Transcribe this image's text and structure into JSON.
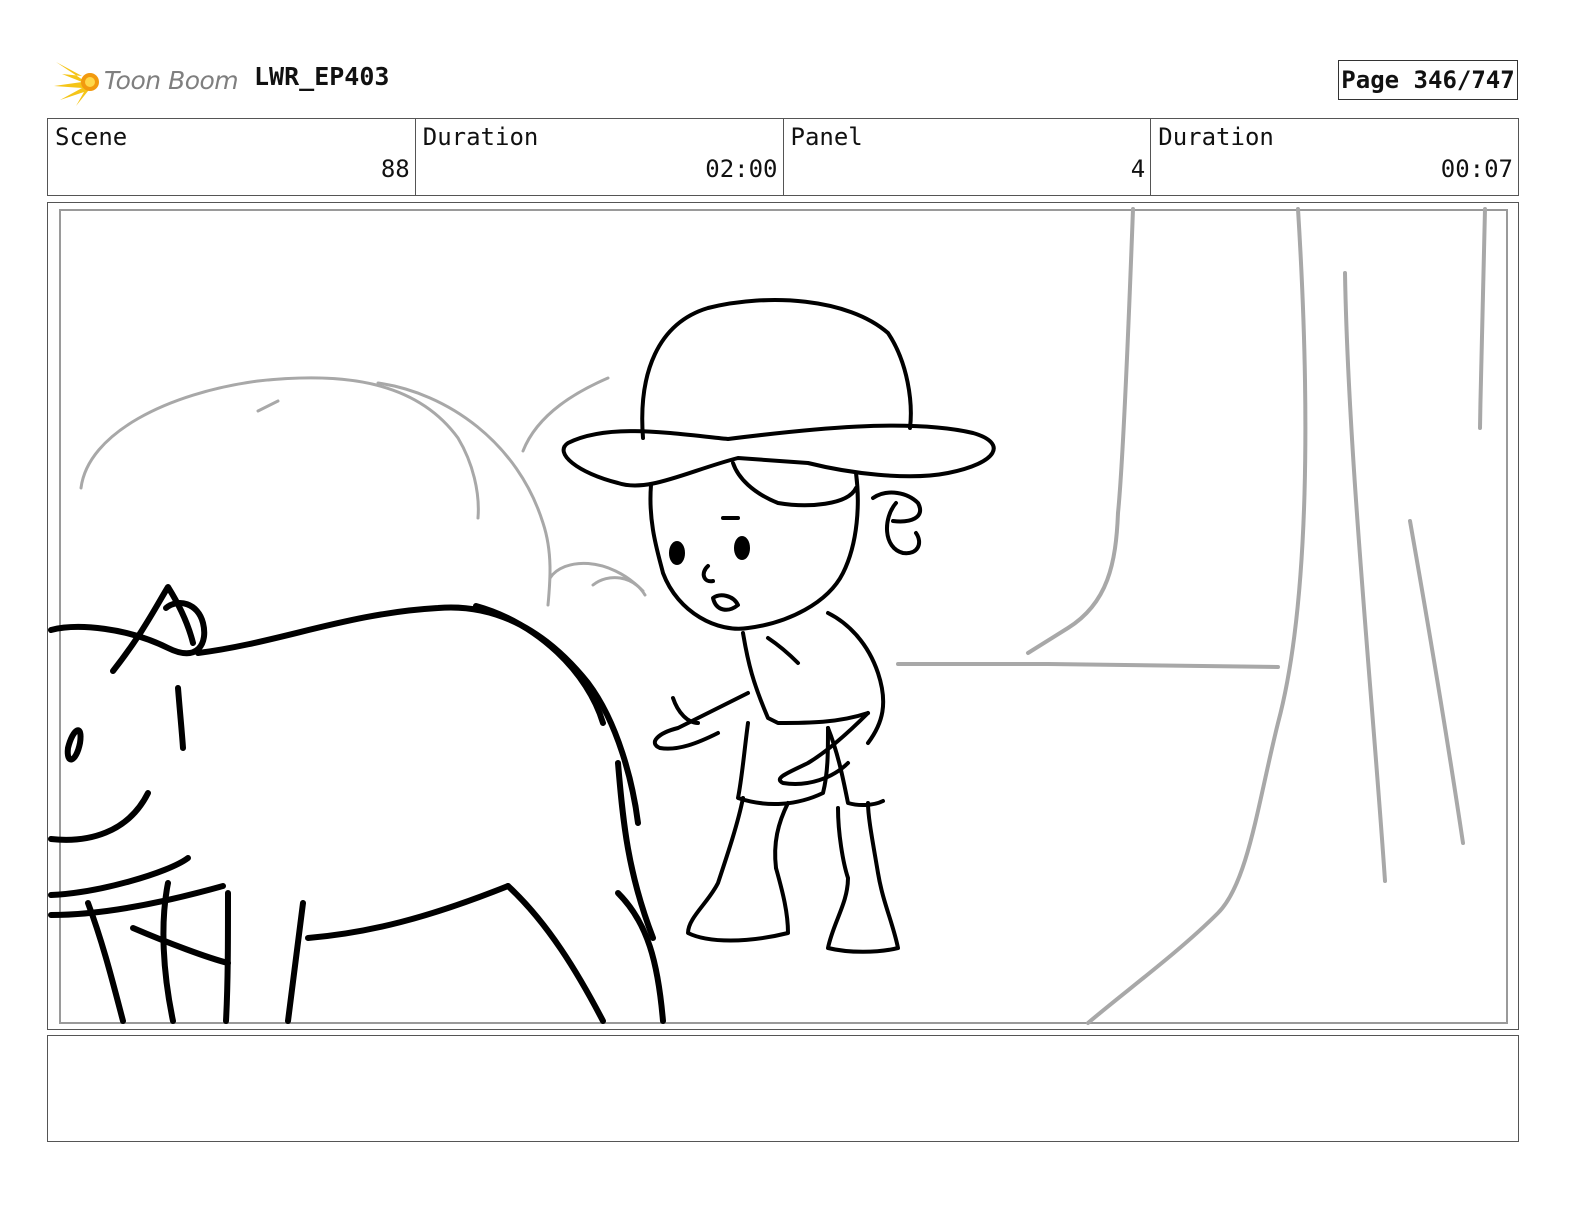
{
  "header": {
    "logo_text": "Toon Boom",
    "project": "LWR_EP403",
    "page": "Page 346/747"
  },
  "info": {
    "scene_label": "Scene",
    "scene_value": "88",
    "scene_duration_label": "Duration",
    "scene_duration_value": "02:00",
    "panel_label": "Panel",
    "panel_value": "4",
    "panel_duration_label": "Duration",
    "panel_duration_value": "00:07"
  },
  "notes": {
    "text": ""
  }
}
